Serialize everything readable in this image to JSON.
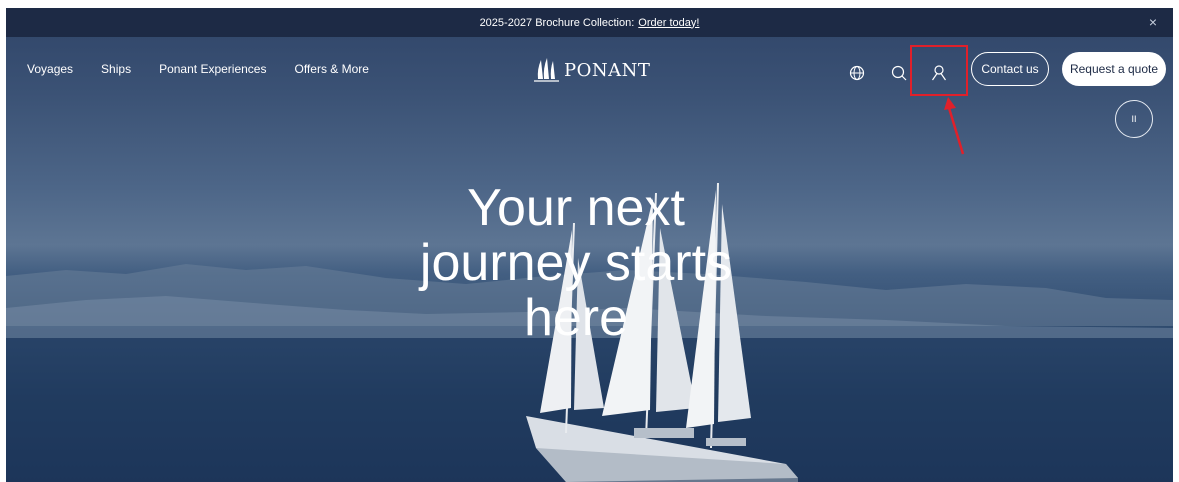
{
  "announcement": {
    "text": "2025-2027 Brochure Collection:",
    "link": "Order today!",
    "close_icon": "×"
  },
  "nav": {
    "items": [
      "Voyages",
      "Ships",
      "Ponant Experiences",
      "Offers & More"
    ]
  },
  "logo": {
    "text": "PONANT"
  },
  "actions": {
    "globe_icon": "globe-icon",
    "search_icon": "search-icon",
    "account_icon": "user-icon",
    "contact_label": "Contact us",
    "quote_label": "Request a quote",
    "pause_label": "II"
  },
  "hero": {
    "title": "Your next journey starts here"
  },
  "colors": {
    "highlight": "#e0202a",
    "bar": "#1d2a45"
  }
}
